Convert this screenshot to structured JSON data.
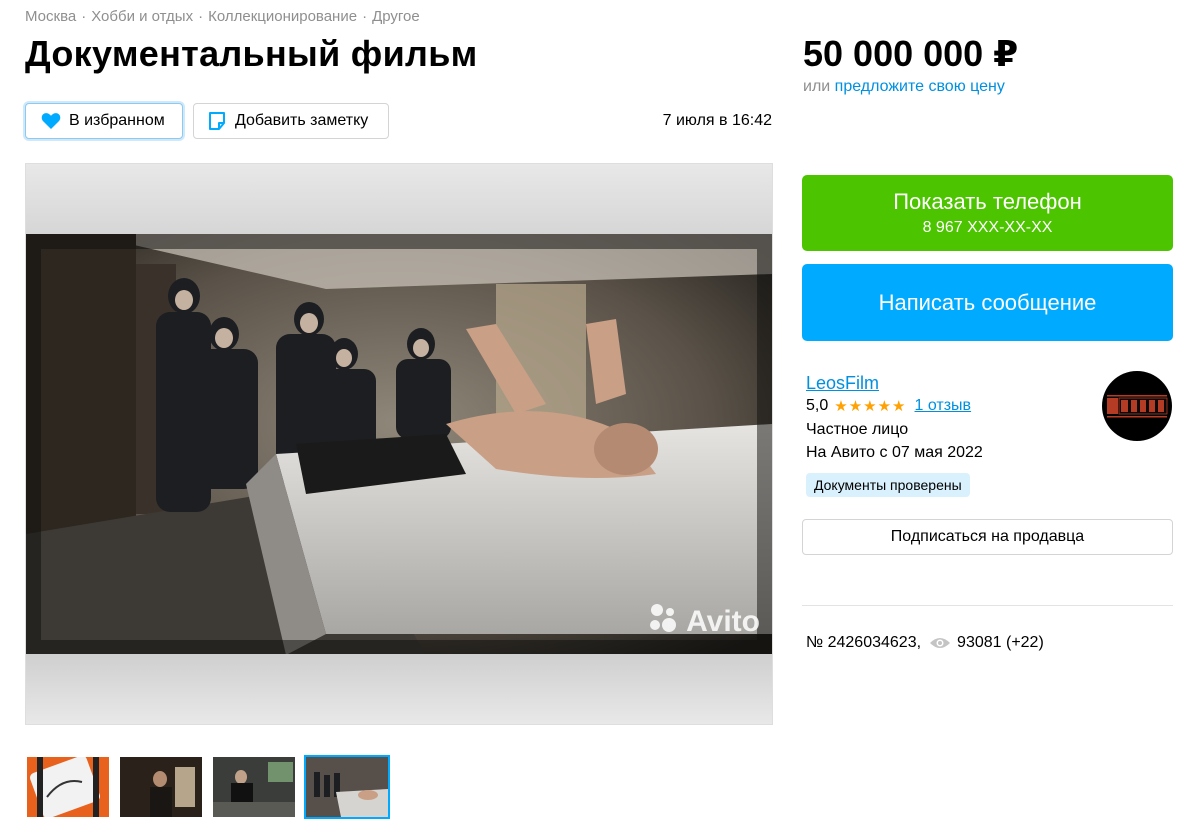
{
  "breadcrumbs": [
    "Москва",
    "Хобби и отдых",
    "Коллекционирование",
    "Другое"
  ],
  "breadcrumb_separator": "·",
  "title": "Документальный фильм",
  "actions": {
    "favorite_label": "В избранном",
    "note_label": "Добавить заметку"
  },
  "date": "7 июля в 16:42",
  "gallery": {
    "watermark": "Avito",
    "thumbnail_count": 4,
    "active_thumbnail": 4
  },
  "price": {
    "value": "50 000 000 ₽",
    "alt_prefix": "или",
    "alt_link": "предложите свою цену"
  },
  "contact": {
    "phone_label": "Показать телефон",
    "phone_number": "8 967 XXX-XX-XX",
    "message_label": "Написать сообщение"
  },
  "seller": {
    "name": "LeosFilm",
    "rating": "5,0",
    "stars": 5,
    "reviews": "1 отзыв",
    "type": "Частное лицо",
    "since": "На Авито с 07 мая 2022",
    "verified_badge": "Документы проверены",
    "subscribe_label": "Подписаться на продавца"
  },
  "listing": {
    "number": "№ 2426034623,",
    "views": "93081 (+22)"
  },
  "colors": {
    "green": "#4cc400",
    "blue": "#00aaff",
    "link": "#0090e0",
    "star": "#ffa100",
    "badge_bg": "#d9f0fd"
  }
}
